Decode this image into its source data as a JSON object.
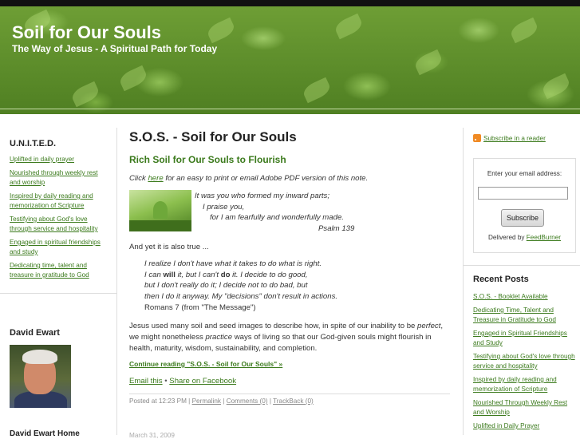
{
  "header": {
    "title": "Soil for Our Souls",
    "tagline": "The Way of Jesus - A Spiritual Path for Today"
  },
  "left_sidebar": {
    "united_title": "U.N.I.T.E.D.",
    "united_items": [
      "Uplifted in daily prayer",
      "Nourished through weekly rest and worship",
      "Inspired by daily reading and memorization of Scripture",
      "Testifying about God's love through service and hospitality",
      "Engaged in spiritual friendships and study",
      "Dedicating time, talent and treasure in gratitude to God"
    ],
    "author_title": "David Ewart",
    "author_home": "David Ewart Home"
  },
  "post": {
    "title": "S.O.S. - Soil for Our Souls",
    "subtitle": "Rich Soil for Our Souls to Flourish",
    "click_prefix": "Click ",
    "click_link": "here",
    "click_suffix": " for an easy to print or email Adobe PDF version of this note.",
    "psalm_lines": [
      "It was you who formed my inward parts;",
      "I praise you,",
      "for I am fearfully and wonderfully made.",
      "Psalm 139"
    ],
    "yet_text": "And yet it is also true ...",
    "quote_line1": "I realize I don't have what it takes to do what is right.",
    "quote_line2_a": "I can ",
    "quote_line2_b": "will",
    "quote_line2_c": " it, but I can't ",
    "quote_line2_d": "do",
    "quote_line2_e": " it. I decide to do good,",
    "quote_line3": "but I don't really do it; I decide not to do bad, but",
    "quote_line4": "then I do it anyway. My \"decisions\" don't result in actions.",
    "quote_source": "Romans 7 (from \"The Message\")",
    "jesus_a": "Jesus used many soil and seed images to describe how, in spite of our inability to be ",
    "jesus_b": "perfect",
    "jesus_c": ", we might nonetheless ",
    "jesus_d": "practice",
    "jesus_e": " ways of living so that our God-given souls might flourish in health, maturity, wisdom, sustainability, and completion.",
    "continue_link": "Continue reading \"S.O.S. - Soil for Our Souls\" »",
    "email_link": "Email this",
    "share_sep": "•",
    "share_link": "Share on Facebook",
    "meta_posted": "Posted at 12:23 PM | ",
    "meta_permalink": "Permalink",
    "meta_sep1": " | ",
    "meta_comments": "Comments (0)",
    "meta_sep2": " | ",
    "meta_trackback": "TrackBack (0)",
    "next_date": "March 31, 2009"
  },
  "right_sidebar": {
    "rss_link": "Subscribe in a reader",
    "email_label": "Enter your email address:",
    "email_value": "",
    "subscribe_button": "Subscribe",
    "delivered_prefix": "Delivered by ",
    "feedburner_link": "FeedBurner",
    "recent_title": "Recent Posts",
    "recent_items": [
      "S.O.S. - Booklet Available",
      "Dedicating Time, Talent and Treasure in Gratitude to God",
      "Engaged in Spiritual Friendships and Study",
      "Testifying about God's love through service and hospitality",
      "Inspired by daily reading and memorization of Scripture",
      "Nourished Through Weekly Rest and Worship",
      "Uplifted in Daily Prayer"
    ]
  },
  "colors": {
    "link_green": "#3b7a1c",
    "banner_green": "#5c8f2b",
    "rss_orange": "#f08a24"
  }
}
